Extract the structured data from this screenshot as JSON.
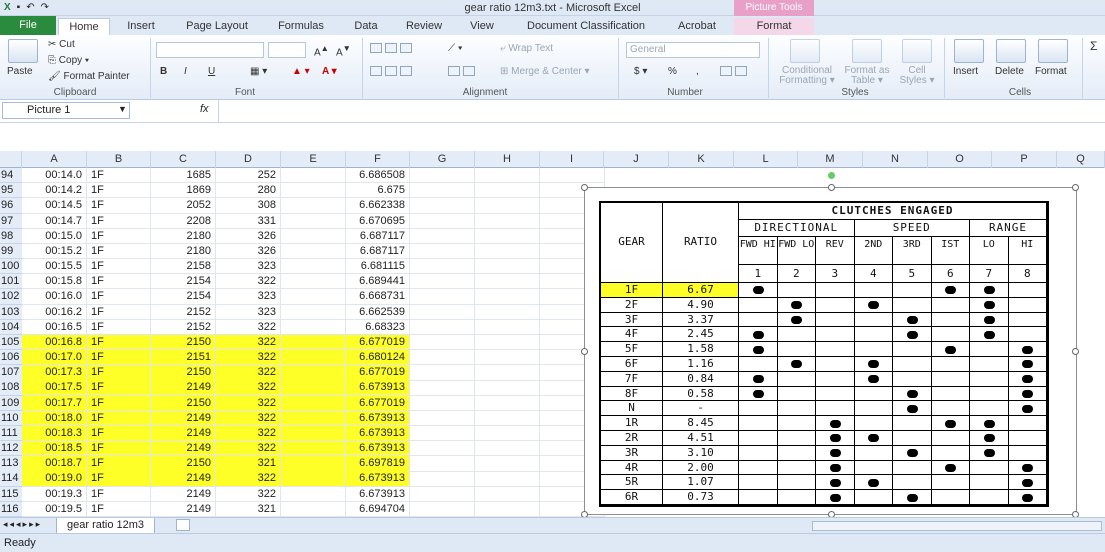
{
  "window": {
    "title": "gear ratio 12m3.txt - Microsoft Excel",
    "context_tab": "Picture Tools"
  },
  "tabs": [
    "File",
    "Home",
    "Insert",
    "Page Layout",
    "Formulas",
    "Data",
    "Review",
    "View",
    "Document Classification",
    "Acrobat",
    "Format"
  ],
  "ribbon": {
    "clipboard": {
      "paste": "Paste",
      "cut": "Cut",
      "copy": "Copy ▾",
      "format_painter": "Format Painter",
      "label": "Clipboard"
    },
    "font": {
      "label": "Font",
      "bold": "B",
      "italic": "I",
      "underline": "U"
    },
    "alignment": {
      "wrap": "Wrap Text",
      "merge": "Merge & Center ▾",
      "label": "Alignment"
    },
    "number": {
      "format": "General",
      "currency": "$ ▾",
      "percent": "%",
      "comma": ",",
      "label": "Number"
    },
    "styles": {
      "conditional": "Conditional Formatting ▾",
      "format_table": "Format as Table ▾",
      "cell_styles": "Cell Styles ▾",
      "label": "Styles"
    },
    "cells": {
      "insert": "Insert",
      "delete": "Delete",
      "format": "Format",
      "label": "Cells"
    }
  },
  "formula_bar": {
    "name_box": "Picture 1",
    "fx": "fx"
  },
  "columns": [
    "A",
    "B",
    "C",
    "D",
    "E",
    "F",
    "G",
    "H",
    "I",
    "J",
    "K",
    "L",
    "M",
    "N",
    "O",
    "P",
    "Q"
  ],
  "rows": [
    {
      "n": "94",
      "a": "00:14.0",
      "b": "1F",
      "c": "1685",
      "d": "252",
      "f": "6.686508",
      "hl": false
    },
    {
      "n": "95",
      "a": "00:14.2",
      "b": "1F",
      "c": "1869",
      "d": "280",
      "f": "6.675",
      "hl": false
    },
    {
      "n": "96",
      "a": "00:14.5",
      "b": "1F",
      "c": "2052",
      "d": "308",
      "f": "6.662338",
      "hl": false
    },
    {
      "n": "97",
      "a": "00:14.7",
      "b": "1F",
      "c": "2208",
      "d": "331",
      "f": "6.670695",
      "hl": false
    },
    {
      "n": "98",
      "a": "00:15.0",
      "b": "1F",
      "c": "2180",
      "d": "326",
      "f": "6.687117",
      "hl": false
    },
    {
      "n": "99",
      "a": "00:15.2",
      "b": "1F",
      "c": "2180",
      "d": "326",
      "f": "6.687117",
      "hl": false
    },
    {
      "n": "100",
      "a": "00:15.5",
      "b": "1F",
      "c": "2158",
      "d": "323",
      "f": "6.681115",
      "hl": false
    },
    {
      "n": "101",
      "a": "00:15.8",
      "b": "1F",
      "c": "2154",
      "d": "322",
      "f": "6.689441",
      "hl": false
    },
    {
      "n": "102",
      "a": "00:16.0",
      "b": "1F",
      "c": "2154",
      "d": "323",
      "f": "6.668731",
      "hl": false
    },
    {
      "n": "103",
      "a": "00:16.2",
      "b": "1F",
      "c": "2152",
      "d": "323",
      "f": "6.662539",
      "hl": false
    },
    {
      "n": "104",
      "a": "00:16.5",
      "b": "1F",
      "c": "2152",
      "d": "322",
      "f": "6.68323",
      "hl": false
    },
    {
      "n": "105",
      "a": "00:16.8",
      "b": "1F",
      "c": "2150",
      "d": "322",
      "f": "6.677019",
      "hl": true
    },
    {
      "n": "106",
      "a": "00:17.0",
      "b": "1F",
      "c": "2151",
      "d": "322",
      "f": "6.680124",
      "hl": true
    },
    {
      "n": "107",
      "a": "00:17.3",
      "b": "1F",
      "c": "2150",
      "d": "322",
      "f": "6.677019",
      "hl": true
    },
    {
      "n": "108",
      "a": "00:17.5",
      "b": "1F",
      "c": "2149",
      "d": "322",
      "f": "6.673913",
      "hl": true
    },
    {
      "n": "109",
      "a": "00:17.7",
      "b": "1F",
      "c": "2150",
      "d": "322",
      "f": "6.677019",
      "hl": true
    },
    {
      "n": "110",
      "a": "00:18.0",
      "b": "1F",
      "c": "2149",
      "d": "322",
      "f": "6.673913",
      "hl": true
    },
    {
      "n": "111",
      "a": "00:18.3",
      "b": "1F",
      "c": "2149",
      "d": "322",
      "f": "6.673913",
      "hl": true
    },
    {
      "n": "112",
      "a": "00:18.5",
      "b": "1F",
      "c": "2149",
      "d": "322",
      "f": "6.673913",
      "hl": true
    },
    {
      "n": "113",
      "a": "00:18.7",
      "b": "1F",
      "c": "2150",
      "d": "321",
      "f": "6.697819",
      "hl": true
    },
    {
      "n": "114",
      "a": "00:19.0",
      "b": "1F",
      "c": "2149",
      "d": "322",
      "f": "6.673913",
      "hl": true
    },
    {
      "n": "115",
      "a": "00:19.3",
      "b": "1F",
      "c": "2149",
      "d": "322",
      "f": "6.673913",
      "hl": false
    },
    {
      "n": "116",
      "a": "00:19.5",
      "b": "1F",
      "c": "2149",
      "d": "321",
      "f": "6.694704",
      "hl": false
    }
  ],
  "gear_table": {
    "title": "CLUTCHES ENGAGED",
    "gear_header": "GEAR",
    "ratio_header": "RATIO",
    "groups": [
      "DIRECTIONAL",
      "SPEED",
      "RANGE"
    ],
    "clutch_names": [
      "FWD HI",
      "FWD LO",
      "REV",
      "2ND",
      "3RD",
      "IST",
      "LO",
      "HI"
    ],
    "clutch_numbers": [
      "1",
      "2",
      "3",
      "4",
      "5",
      "6",
      "7",
      "8"
    ],
    "gears": [
      {
        "gear": "1F",
        "ratio": "6.67",
        "on": [
          1,
          6,
          7
        ]
      },
      {
        "gear": "2F",
        "ratio": "4.90",
        "on": [
          2,
          4,
          7
        ]
      },
      {
        "gear": "3F",
        "ratio": "3.37",
        "on": [
          2,
          5,
          7
        ]
      },
      {
        "gear": "4F",
        "ratio": "2.45",
        "on": [
          1,
          5,
          7
        ]
      },
      {
        "gear": "5F",
        "ratio": "1.58",
        "on": [
          1,
          6,
          8
        ]
      },
      {
        "gear": "6F",
        "ratio": "1.16",
        "on": [
          2,
          4,
          8
        ]
      },
      {
        "gear": "7F",
        "ratio": "0.84",
        "on": [
          1,
          4,
          8
        ]
      },
      {
        "gear": "8F",
        "ratio": "0.58",
        "on": [
          1,
          5,
          8
        ]
      },
      {
        "gear": "N",
        "ratio": "-",
        "on": [
          5,
          8
        ]
      },
      {
        "gear": "1R",
        "ratio": "8.45",
        "on": [
          3,
          6,
          7
        ]
      },
      {
        "gear": "2R",
        "ratio": "4.51",
        "on": [
          3,
          4,
          7
        ]
      },
      {
        "gear": "3R",
        "ratio": "3.10",
        "on": [
          3,
          5,
          7
        ]
      },
      {
        "gear": "4R",
        "ratio": "2.00",
        "on": [
          3,
          6,
          8
        ]
      },
      {
        "gear": "5R",
        "ratio": "1.07",
        "on": [
          3,
          4,
          8
        ]
      },
      {
        "gear": "6R",
        "ratio": "0.73",
        "on": [
          3,
          5,
          8
        ]
      }
    ],
    "highlight_color": "#ffff28"
  },
  "sheet_tab": "gear ratio 12m3",
  "status": "Ready"
}
